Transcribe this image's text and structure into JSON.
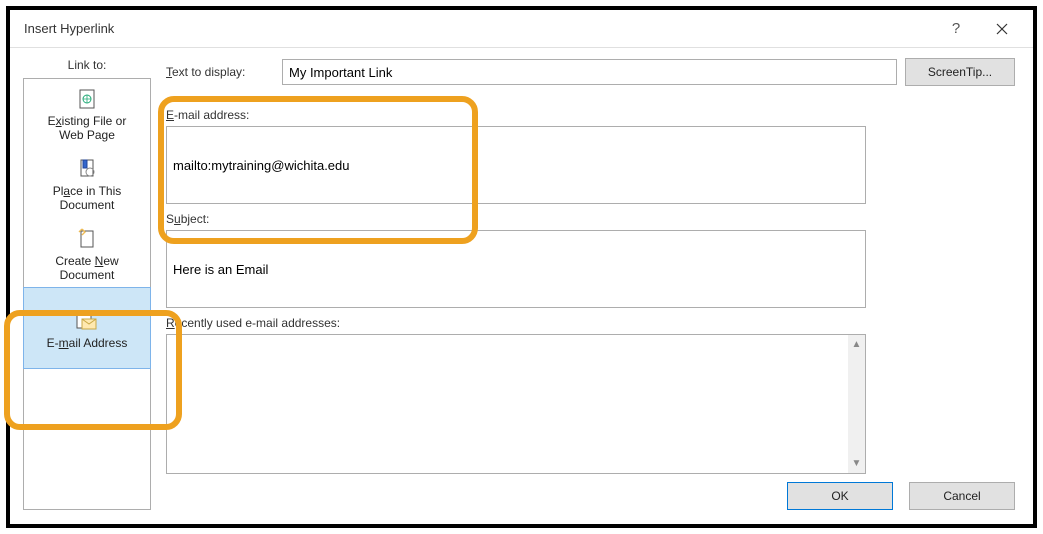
{
  "titlebar": {
    "title": "Insert Hyperlink"
  },
  "linkto": {
    "label": "Link to:",
    "items": [
      {
        "label_line1": "Existing File or",
        "label_line2": "Web Page",
        "accel": "x"
      },
      {
        "label_line1": "Place in This",
        "label_line2": "Document",
        "accel": "A"
      },
      {
        "label_line1": "Create New",
        "label_line2": "Document",
        "accel": "N"
      },
      {
        "label_line1": "E-mail Address",
        "label_line2": "",
        "accel": "m"
      }
    ]
  },
  "display": {
    "label": "Text to display:",
    "value": "My Important Link",
    "accel": "T"
  },
  "screentip": {
    "label": "ScreenTip..."
  },
  "email": {
    "label": "E-mail address:",
    "value": "mailto:mytraining@wichita.edu",
    "accel": "E"
  },
  "subject": {
    "label": "Subject:",
    "value": "Here is an Email",
    "accel": "u"
  },
  "recent": {
    "label": "Recently used e-mail addresses:",
    "accel": "R"
  },
  "buttons": {
    "ok": "OK",
    "cancel": "Cancel"
  }
}
